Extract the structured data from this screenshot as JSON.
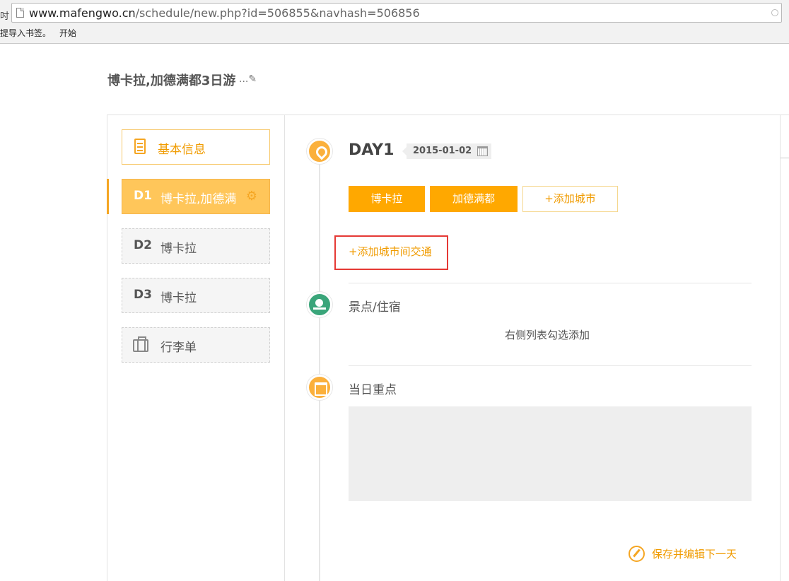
{
  "browser": {
    "left_edge_char": "吋",
    "url_domain": "www.mafengwo.cn",
    "url_path": "/schedule/new.php?id=506855&navhash=506856",
    "bookmarks": [
      "提导入书签。",
      "开始"
    ]
  },
  "trip": {
    "title": "博卡拉,加德满都3日游",
    "edit_suffix": "...✎"
  },
  "sidebar": {
    "basic_info": "基本信息",
    "days": [
      {
        "num": "D1",
        "cities": "博卡拉,加德满",
        "active": true
      },
      {
        "num": "D2",
        "cities": "博卡拉",
        "active": false
      },
      {
        "num": "D3",
        "cities": "博卡拉",
        "active": false
      }
    ],
    "luggage": "行李单"
  },
  "day": {
    "title": "DAY1",
    "date": "2015-01-02",
    "cities": [
      "博卡拉",
      "加德满都"
    ],
    "add_city": "+添加城市",
    "add_transport": "+添加城市间交通"
  },
  "sections": {
    "spots_title": "景点/住宿",
    "spots_hint": "右侧列表勾选添加",
    "highlights_title": "当日重点"
  },
  "footer": {
    "save_next": "保存并编辑下一天"
  },
  "colors": {
    "accent": "#ffa800",
    "accent_text": "#f09b00",
    "green": "#3aa57a",
    "highlight_box": "#e53935"
  }
}
